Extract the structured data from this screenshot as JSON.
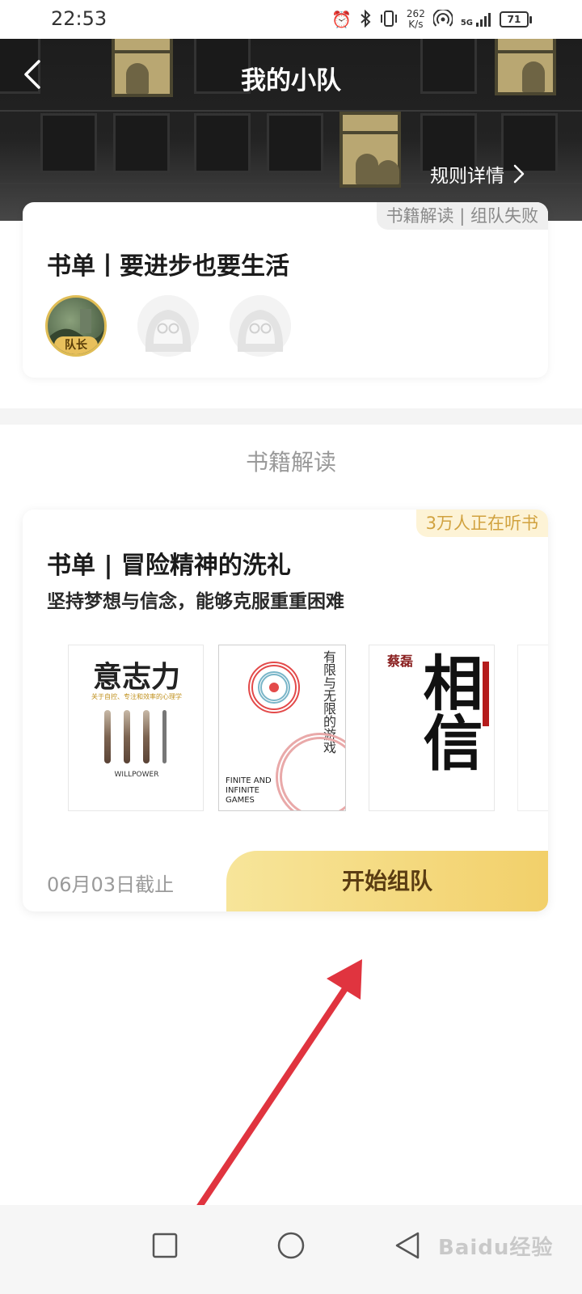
{
  "status_bar": {
    "time": "22:53",
    "net_speed_value": "262",
    "net_speed_unit": "K/s",
    "network": "5G",
    "battery": "71"
  },
  "header": {
    "title": "我的小队",
    "rules_link": "规则详情"
  },
  "team_card": {
    "status_badge": "书籍解读 | 组队失败",
    "title": "书单丨要进步也要生活",
    "leader_badge": "队长"
  },
  "section_title": "书籍解读",
  "book_card": {
    "listening_badge": "3万人正在听书",
    "title": "书单 | 冒险精神的洗礼",
    "subtitle": "坚持梦想与信念，能够克服重重困难",
    "covers": [
      {
        "title": "意志力",
        "subtitle": "关于自控、专注和效率的心理学",
        "english": "WILLPOWER"
      },
      {
        "title": "有限与无限的游戏",
        "english": "FINITE AND INFINITE GAMES"
      },
      {
        "title": "相信",
        "brand": "蔡磊"
      }
    ],
    "deadline": "06月03日截止",
    "start_button": "开始组队"
  },
  "watermark": "Baidu经验",
  "colors": {
    "accent_gold": "#f2d06a",
    "badge_text_gold": "#d1a23f",
    "arrow_red": "#e0343f"
  }
}
